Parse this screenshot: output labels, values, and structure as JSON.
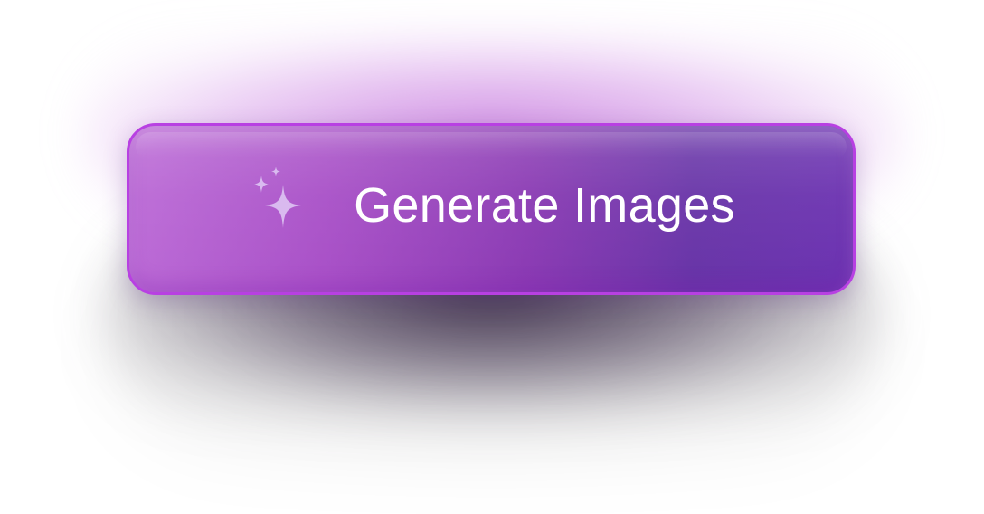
{
  "button": {
    "label": "Generate Images",
    "icon": "sparkles-icon"
  },
  "colors": {
    "background": "#ffffff",
    "button_left": "#bb69d6",
    "button_right": "#6733a7",
    "button_border": "#b840e2",
    "label": "#ffffff",
    "icon": "#dcc2f2"
  }
}
